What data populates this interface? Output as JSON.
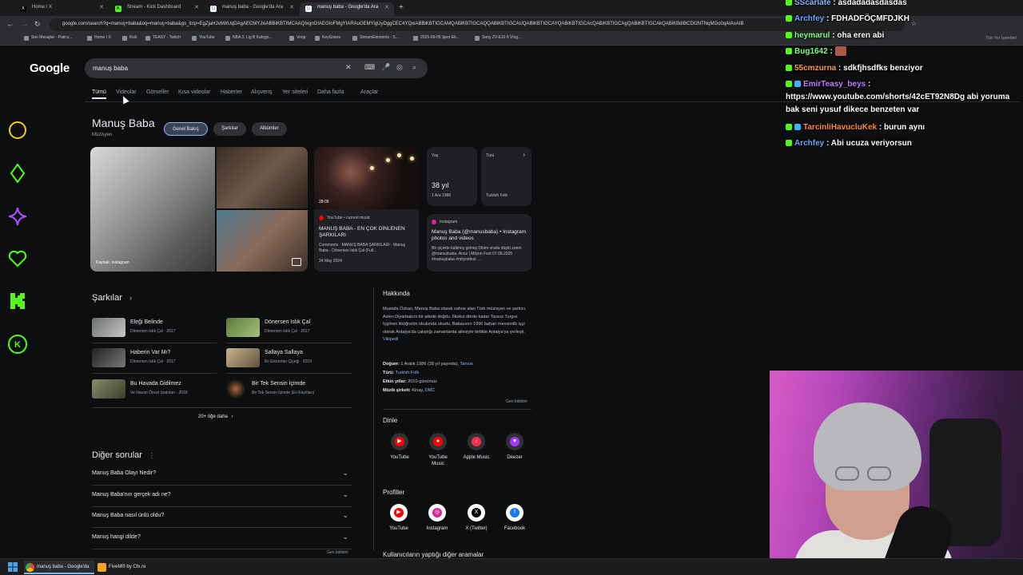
{
  "browser": {
    "tabs": [
      {
        "label": "Home / X",
        "icon": "x-icon"
      },
      {
        "label": "Stream - Kick Dashboard",
        "icon": "kick-icon"
      },
      {
        "label": "manuş baba - Google'da Ara",
        "icon": "google-icon"
      },
      {
        "label": "manuş baba - Google'da Ara",
        "icon": "google-icon",
        "active": true
      }
    ],
    "new_tab": "+",
    "url": "google.com/search?q=manuş+baba&oq=manuş+baba&gs_lcrp=EgZjaHJvbWUqDAgAECMYJxiABBiKBTIMCAAQIxgnGIAEGIoFMgYIARAuGEMYigUyDggCEC4YQxiABBiKBTIGCAMQABiKBTIGCAQQABiKBTIGCAUQABiKBTIGCAYQABiKBTIGCAcQABiKBTIGCAgQABiKBTIGCAkQABiKBdIBCDI2NTNqMGo0qAIAsAIB",
    "bookmarks": [
      "Son Mesajlar - Patics...",
      "Home / X",
      "Kick",
      "TEASY - Twitch",
      "YouTube",
      "NBA 3. Lig B Katego...",
      "Voop",
      "KeyGivers",
      "StreamElements - S...",
      "2025-09-06 Spor Ek...",
      "Sony ZV-E10 II Vlog..."
    ],
    "all_bookmarks": "Tüm Yer İşaretleri"
  },
  "google": {
    "logo": "Google",
    "query": "manuş baba",
    "nav_tabs": [
      "Tümü",
      "Videolar",
      "Görseller",
      "Kısa videolar",
      "Haberler",
      "Alışveriş",
      "Yer siteleri",
      "Daha fazla",
      "Araçlar"
    ],
    "kp": {
      "title": "Manuş Baba",
      "subtitle": "Müzisyen",
      "pills": [
        "Genel Bakış",
        "Şarkılar",
        "Albümler"
      ],
      "photo_credit": "Kaynak: Instagram",
      "yt_card": {
        "duration": "28:05",
        "source": "YouTube • current music",
        "title": "MANUŞ BABA - EN ÇOK DİNLENEN ŞARKILARI",
        "body": "Comments · MANUŞ BABA ŞARKILARI · Manuş Baba - Dönersen Islık Çal (Full...",
        "date": "24 May 2024"
      },
      "age_card": {
        "label": "Yaş",
        "value": "38 yıl",
        "date": "1 Ara 1986"
      },
      "genre_card": {
        "label": "Türü",
        "value": "Turkish Folk"
      },
      "ig_card": {
        "source": "Instagram",
        "title": "Manuş Baba (@manusbaba) • Instagram photos and videos",
        "body": "Bir çiçekle kalkmış gelmiş Dibim orada düştü zaten @manusbaba. Arsız | Milyon Fest 07.08.2025 #manuşbaba #milyonfest ..."
      }
    },
    "songs": {
      "heading": "Şarkılar",
      "items": [
        {
          "title": "Eleği Belinde",
          "meta": "Dönersen Islık Çal · 2017"
        },
        {
          "title": "Dönersen Islık Çal",
          "meta": "Dönersen Islık Çal · 2017"
        },
        {
          "title": "Haberin Var Mı?",
          "meta": "Dönersen Islık Çal · 2017"
        },
        {
          "title": "Sallaya Sallaya",
          "meta": "İki Gözümün Çiçeği · 2019"
        },
        {
          "title": "Bu Havada Gidilmez",
          "meta": "Ve Nazan Öncel Şarkıları · 2018"
        },
        {
          "title": "Bir Tek Sensin İçimde",
          "meta": "Bir Tek Sensin İçimde (Ev Kayıtları)"
        }
      ],
      "more": "20+ öğe daha"
    },
    "paa": {
      "heading": "Diğer sorular",
      "items": [
        "Manuş Baba Olayı Nedir?",
        "Manuş Baba'nın gerçek adı ne?",
        "Manuş Baba nasıl ünlü oldu?",
        "Manuş hangi dilde?"
      ],
      "feedback": "Geri bildirim"
    },
    "about": {
      "heading": "Hakkında",
      "text": "Mustafa Özkan, Manuş Baba olarak sahne alan Türk müzisyen ve şarkıcı. Aslen Diyarbakırlı bir ailede doğdu. İlkokul dörde kadar Tarsus Turgut İçgören ilköğretim okulunda okudu. Babasının 1996 baharı mevsimlik işçi olarak Antalya'da çalıştığı zamanlarda ailesiyle birlikte Antalya'ya yerleşti.",
      "wiki": "Vikipedi",
      "facts": [
        {
          "label": "Doğum:",
          "value": "1 Aralık 1986 (38 yıl yaşında),",
          "link": "Tarsus"
        },
        {
          "label": "Türü:",
          "value": "",
          "link": "Turkish Folk"
        },
        {
          "label": "Etkin yıllar:",
          "value": "2010-günümüz",
          "link": ""
        },
        {
          "label": "Müzik şirketi:",
          "value": "Kinay,",
          "link": "DMC"
        }
      ],
      "feedback": "Geri bildirim"
    },
    "listen": {
      "heading": "Dinle",
      "items": [
        {
          "label": "YouTube",
          "icon": "youtube-icon",
          "color": "#ff0000"
        },
        {
          "label": "YouTube Music",
          "icon": "youtube-music-icon",
          "color": "#ff0000"
        },
        {
          "label": "Apple Music",
          "icon": "apple-music-icon",
          "color": "#fa2d48"
        },
        {
          "label": "Deezer",
          "icon": "deezer-icon",
          "color": "#a238ff"
        }
      ]
    },
    "profiles": {
      "heading": "Profiller",
      "items": [
        {
          "label": "YouTube",
          "icon": "youtube-icon",
          "color": "#ff0000"
        },
        {
          "label": "Instagram",
          "icon": "instagram-icon",
          "color": "#d6249f"
        },
        {
          "label": "X (Twitter)",
          "icon": "x-icon",
          "color": "#000000"
        },
        {
          "label": "Facebook",
          "icon": "facebook-icon",
          "color": "#1877f2"
        }
      ]
    },
    "also_search": "Kullanıcıların yaptığı diğer aramalar"
  },
  "chat": [
    {
      "user": "SScarlate",
      "color": "#8ab4f8",
      "message": "asdadadasdasdas"
    },
    {
      "user": "Archfey",
      "color": "#6aa7ff",
      "message": "FDHADFÖÇMFDJKH"
    },
    {
      "user": "heymarul",
      "color": "#7dff7d",
      "message": "oha eren abi"
    },
    {
      "user": "Bug1642",
      "color": "#7dff7d",
      "message": ""
    },
    {
      "user": "55cmzurna",
      "color": "#ff9a3c",
      "message": "sdkfjhsdfks benziyor"
    },
    {
      "user": "EmirTeasy_beys",
      "color": "#c07bff",
      "message": "https://www.youtube.com/shorts/42cET92N8Dg abi yoruma bak seni yusuf dikece benzeten var"
    },
    {
      "user": "TarcinliHavucluKek",
      "color": "#ff8a3c",
      "message": "burun aynı"
    },
    {
      "user": "Archfey",
      "color": "#6aa7ff",
      "message": "Abi ucuza veriyorsun"
    }
  ],
  "taskbar": [
    {
      "label": "manuş baba - Google'da",
      "icon": "chrome-icon",
      "active": true
    },
    {
      "label": "FiveM® by Cfx.re",
      "icon": "fivem-icon",
      "active": false
    }
  ],
  "colors": {
    "accent": "#8ab4f8",
    "kick_green": "#53fc18"
  }
}
